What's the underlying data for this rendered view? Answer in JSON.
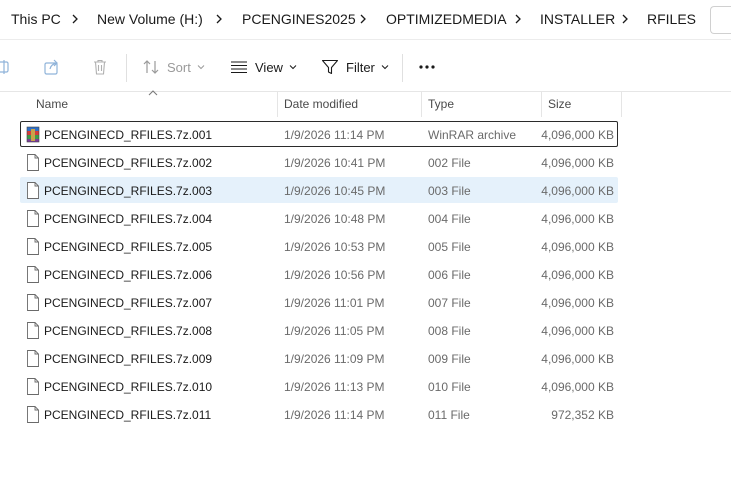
{
  "breadcrumb": {
    "items": [
      "This PC",
      "New Volume (H:)",
      "PCENGINES2025",
      "OPTIMIZEDMEDIA",
      "INSTALLER",
      "RFILES"
    ]
  },
  "toolbar": {
    "sort_label": "Sort",
    "view_label": "View",
    "filter_label": "Filter",
    "more_label": "···"
  },
  "columns": {
    "name": "Name",
    "date": "Date modified",
    "type": "Type",
    "size": "Size"
  },
  "files": [
    {
      "name": "PCENGINECD_RFILES.7z.001",
      "date": "1/9/2026 11:14 PM",
      "type": "WinRAR archive",
      "size": "4,096,000 KB",
      "icon": "winrar-archive-icon"
    },
    {
      "name": "PCENGINECD_RFILES.7z.002",
      "date": "1/9/2026 10:41 PM",
      "type": "002 File",
      "size": "4,096,000 KB",
      "icon": "generic-file-icon"
    },
    {
      "name": "PCENGINECD_RFILES.7z.003",
      "date": "1/9/2026 10:45 PM",
      "type": "003 File",
      "size": "4,096,000 KB",
      "icon": "generic-file-icon"
    },
    {
      "name": "PCENGINECD_RFILES.7z.004",
      "date": "1/9/2026 10:48 PM",
      "type": "004 File",
      "size": "4,096,000 KB",
      "icon": "generic-file-icon"
    },
    {
      "name": "PCENGINECD_RFILES.7z.005",
      "date": "1/9/2026 10:53 PM",
      "type": "005 File",
      "size": "4,096,000 KB",
      "icon": "generic-file-icon"
    },
    {
      "name": "PCENGINECD_RFILES.7z.006",
      "date": "1/9/2026 10:56 PM",
      "type": "006 File",
      "size": "4,096,000 KB",
      "icon": "generic-file-icon"
    },
    {
      "name": "PCENGINECD_RFILES.7z.007",
      "date": "1/9/2026 11:01 PM",
      "type": "007 File",
      "size": "4,096,000 KB",
      "icon": "generic-file-icon"
    },
    {
      "name": "PCENGINECD_RFILES.7z.008",
      "date": "1/9/2026 11:05 PM",
      "type": "008 File",
      "size": "4,096,000 KB",
      "icon": "generic-file-icon"
    },
    {
      "name": "PCENGINECD_RFILES.7z.009",
      "date": "1/9/2026 11:09 PM",
      "type": "009 File",
      "size": "4,096,000 KB",
      "icon": "generic-file-icon"
    },
    {
      "name": "PCENGINECD_RFILES.7z.010",
      "date": "1/9/2026 11:13 PM",
      "type": "010 File",
      "size": "4,096,000 KB",
      "icon": "generic-file-icon"
    },
    {
      "name": "PCENGINECD_RFILES.7z.011",
      "date": "1/9/2026 11:14 PM",
      "type": "011 File",
      "size": "972,352 KB",
      "icon": "generic-file-icon"
    }
  ],
  "state": {
    "focused_row": 0,
    "hovered_row": 2
  },
  "colors": {
    "hover": "#e5f1fb",
    "focus_border": "#2b2b2b"
  }
}
